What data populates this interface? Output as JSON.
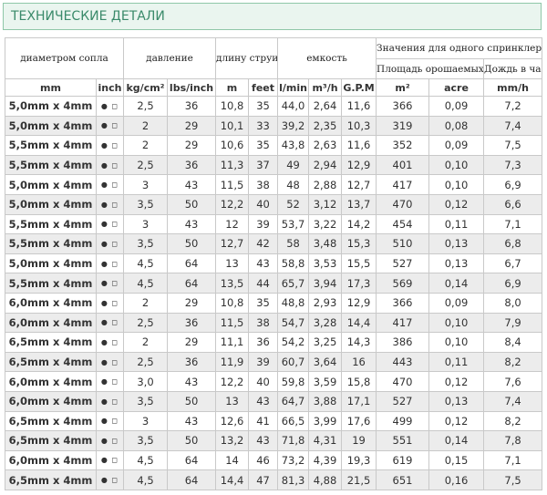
{
  "title": "ТЕХНИЧЕСКИЕ ДЕТАЛИ",
  "headers": {
    "nozzle": "диаметром сопла",
    "pressure": "давление",
    "jet": "длину струи",
    "capacity": "емкость",
    "per_sprinkler": "Значения для одного спринклера",
    "area": "Площадь орошаемых",
    "rain": "Дождь в час"
  },
  "units": [
    "mm",
    "inch",
    "kg/cm²",
    "lbs/inch",
    "m",
    "feet",
    "l/min",
    "m³/h",
    "G.P.M",
    "m²",
    "acre",
    "mm/h"
  ],
  "inch_icons": "● ◻",
  "rows": [
    [
      "5,0mm x 4mm",
      "2,5",
      "36",
      "10,8",
      "35",
      "44,0",
      "2,64",
      "11,6",
      "366",
      "0,09",
      "7,2"
    ],
    [
      "5,0mm x 4mm",
      "2",
      "29",
      "10,1",
      "33",
      "39,2",
      "2,35",
      "10,3",
      "319",
      "0,08",
      "7,4"
    ],
    [
      "5,5mm x 4mm",
      "2",
      "29",
      "10,6",
      "35",
      "43,8",
      "2,63",
      "11,6",
      "352",
      "0,09",
      "7,5"
    ],
    [
      "5,5mm x 4mm",
      "2,5",
      "36",
      "11,3",
      "37",
      "49",
      "2,94",
      "12,9",
      "401",
      "0,10",
      "7,3"
    ],
    [
      "5,0mm x 4mm",
      "3",
      "43",
      "11,5",
      "38",
      "48",
      "2,88",
      "12,7",
      "417",
      "0,10",
      "6,9"
    ],
    [
      "5,0mm x 4mm",
      "3,5",
      "50",
      "12,2",
      "40",
      "52",
      "3,12",
      "13,7",
      "470",
      "0,12",
      "6,6"
    ],
    [
      "5,5mm x 4mm",
      "3",
      "43",
      "12",
      "39",
      "53,7",
      "3,22",
      "14,2",
      "454",
      "0,11",
      "7,1"
    ],
    [
      "5,5mm x 4mm",
      "3,5",
      "50",
      "12,7",
      "42",
      "58",
      "3,48",
      "15,3",
      "510",
      "0,13",
      "6,8"
    ],
    [
      "5,0mm x 4mm",
      "4,5",
      "64",
      "13",
      "43",
      "58,8",
      "3,53",
      "15,5",
      "527",
      "0,13",
      "6,7"
    ],
    [
      "5,5mm x 4mm",
      "4,5",
      "64",
      "13,5",
      "44",
      "65,7",
      "3,94",
      "17,3",
      "569",
      "0,14",
      "6,9"
    ],
    [
      "6,0mm x 4mm",
      "2",
      "29",
      "10,8",
      "35",
      "48,8",
      "2,93",
      "12,9",
      "366",
      "0,09",
      "8,0"
    ],
    [
      "6,0mm x 4mm",
      "2,5",
      "36",
      "11,5",
      "38",
      "54,7",
      "3,28",
      "14,4",
      "417",
      "0,10",
      "7,9"
    ],
    [
      "6,5mm x 4mm",
      "2",
      "29",
      "11,1",
      "36",
      "54,2",
      "3,25",
      "14,3",
      "386",
      "0,10",
      "8,4"
    ],
    [
      "6,5mm x 4mm",
      "2,5",
      "36",
      "11,9",
      "39",
      "60,7",
      "3,64",
      "16",
      "443",
      "0,11",
      "8,2"
    ],
    [
      "6,0mm x 4mm",
      "3,0",
      "43",
      "12,2",
      "40",
      "59,8",
      "3,59",
      "15,8",
      "470",
      "0,12",
      "7,6"
    ],
    [
      "6,0mm x 4mm",
      "3,5",
      "50",
      "13",
      "43",
      "64,7",
      "3,88",
      "17,1",
      "527",
      "0,13",
      "7,4"
    ],
    [
      "6,5mm x 4mm",
      "3",
      "43",
      "12,6",
      "41",
      "66,5",
      "3,99",
      "17,6",
      "499",
      "0,12",
      "8,2"
    ],
    [
      "6,5mm x 4mm",
      "3,5",
      "50",
      "13,2",
      "43",
      "71,8",
      "4,31",
      "19",
      "551",
      "0,14",
      "7,8"
    ],
    [
      "6,0mm x 4mm",
      "4,5",
      "64",
      "14",
      "46",
      "73,2",
      "4,39",
      "19,3",
      "619",
      "0,15",
      "7,1"
    ],
    [
      "6,5mm x 4mm",
      "4,5",
      "64",
      "14,4",
      "47",
      "81,3",
      "4,88",
      "21,5",
      "651",
      "0,16",
      "7,5"
    ]
  ]
}
